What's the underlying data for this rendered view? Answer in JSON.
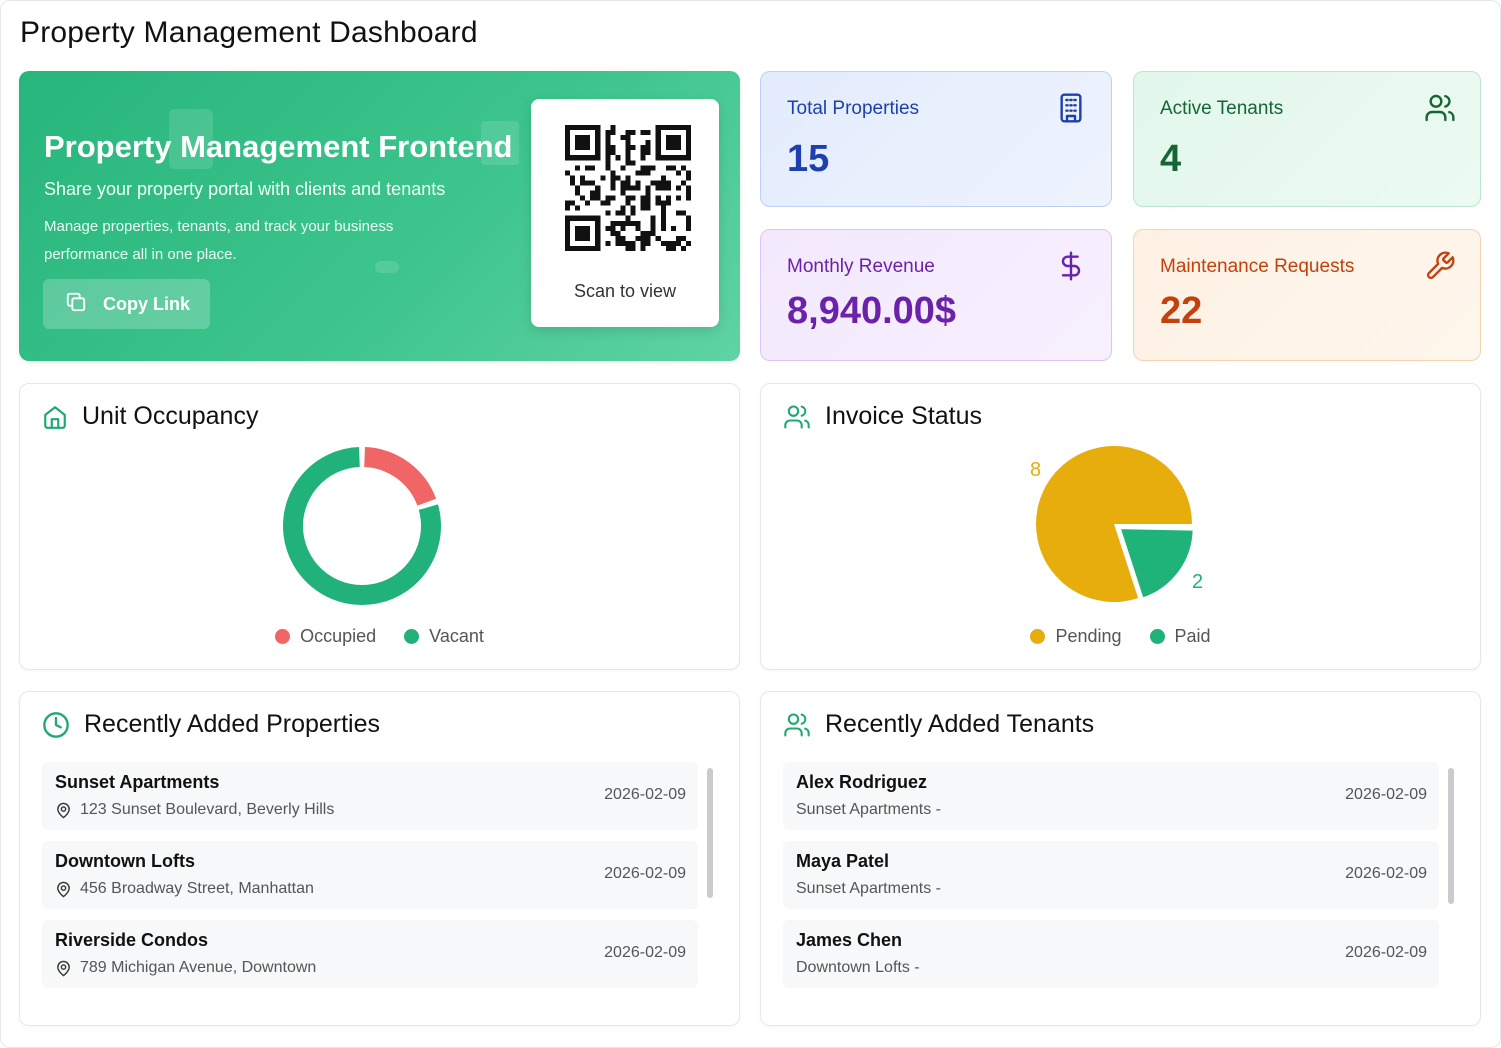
{
  "page": {
    "title": "Property Management Dashboard"
  },
  "hero": {
    "title": "Property Management Frontend",
    "subtitle": "Share your property portal with clients and tenants",
    "description": "Manage properties, tenants, and track your business performance all in one place.",
    "copy_button": "Copy Link",
    "qr_label": "Scan to view",
    "accent": "#2dba80"
  },
  "stats": {
    "total_properties": {
      "label": "Total Properties",
      "value": "15",
      "icon": "building-icon",
      "color": "#1e40af"
    },
    "active_tenants": {
      "label": "Active Tenants",
      "value": "4",
      "icon": "users-icon",
      "color": "#166534"
    },
    "monthly_revenue": {
      "label": "Monthly Revenue",
      "value": "8,940.00$",
      "icon": "dollar-icon",
      "color": "#6b21a8"
    },
    "maintenance_requests": {
      "label": "Maintenance Requests",
      "value": "22",
      "icon": "wrench-icon",
      "color": "#c2410c"
    }
  },
  "occupancy": {
    "title": "Unit Occupancy",
    "legend": [
      "Occupied",
      "Vacant"
    ]
  },
  "invoice": {
    "title": "Invoice Status",
    "legend": [
      "Pending",
      "Paid"
    ]
  },
  "chart_data": [
    {
      "type": "pie",
      "title": "Unit Occupancy",
      "variant": "donut",
      "categories": [
        "Occupied",
        "Vacant"
      ],
      "values": [
        1,
        4
      ],
      "colors": [
        "#f06565",
        "#20b27a"
      ]
    },
    {
      "type": "pie",
      "title": "Invoice Status",
      "categories": [
        "Pending",
        "Paid"
      ],
      "values": [
        8,
        2
      ],
      "data_labels": [
        "8",
        "2"
      ],
      "colors": [
        "#e6ad0c",
        "#1fb37a"
      ]
    }
  ],
  "recent_properties": {
    "title": "Recently Added Properties",
    "items": [
      {
        "name": "Sunset Apartments",
        "address": "123 Sunset Boulevard, Beverly Hills",
        "date": "2026-02-09"
      },
      {
        "name": "Downtown Lofts",
        "address": "456 Broadway Street, Manhattan",
        "date": "2026-02-09"
      },
      {
        "name": "Riverside Condos",
        "address": "789 Michigan Avenue, Downtown",
        "date": "2026-02-09"
      }
    ]
  },
  "recent_tenants": {
    "title": "Recently Added Tenants",
    "items": [
      {
        "name": "Alex Rodriguez",
        "property": "Sunset Apartments -",
        "date": "2026-02-09"
      },
      {
        "name": "Maya Patel",
        "property": "Sunset Apartments -",
        "date": "2026-02-09"
      },
      {
        "name": "James Chen",
        "property": "Downtown Lofts -",
        "date": "2026-02-09"
      }
    ]
  }
}
